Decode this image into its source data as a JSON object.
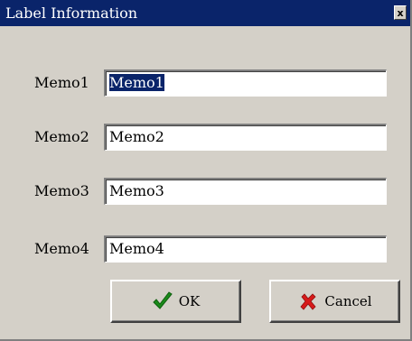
{
  "window": {
    "title": "Label Information",
    "close_glyph": "x",
    "colors": {
      "titlebar": "#0a246a",
      "face": "#d4d0c8"
    }
  },
  "memos": [
    {
      "label": "Memo1",
      "value": "Memo1",
      "selected": true
    },
    {
      "label": "Memo2",
      "value": "Memo2",
      "selected": false
    },
    {
      "label": "Memo3",
      "value": "Memo3",
      "selected": false
    },
    {
      "label": "Memo4",
      "value": "Memo4",
      "selected": false
    }
  ],
  "buttons": {
    "ok": {
      "label": "OK",
      "icon": "green-checkmark-icon",
      "icon_color": "#1a8a1a"
    },
    "cancel": {
      "label": "Cancel",
      "icon": "red-x-icon",
      "icon_color": "#d81a1a"
    }
  }
}
